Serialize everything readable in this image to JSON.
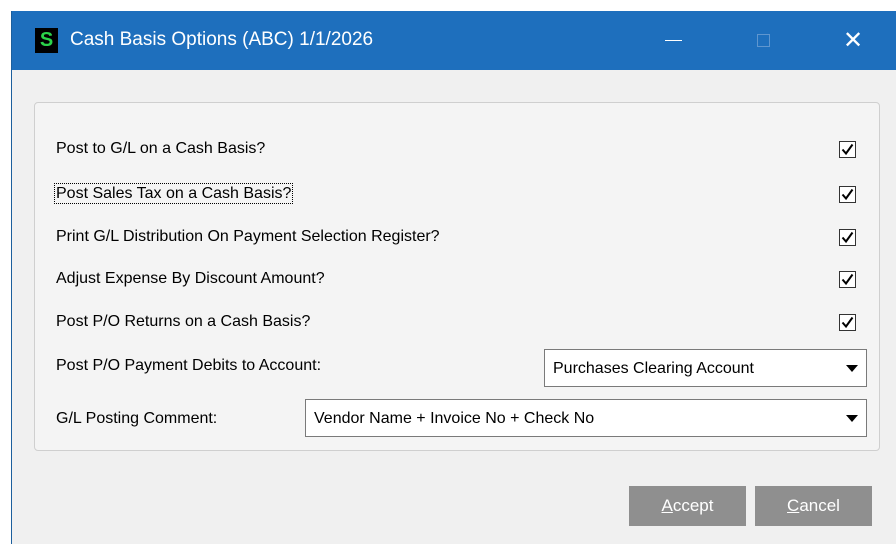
{
  "window": {
    "app_icon_letter": "S",
    "title": "Cash Basis Options (ABC) 1/1/2026",
    "minimize_glyph": "—",
    "close_glyph": "✕"
  },
  "options": [
    {
      "label": "Post to G/L on a Cash Basis?",
      "checked": true
    },
    {
      "label": "Post Sales Tax on a Cash Basis?",
      "checked": true
    },
    {
      "label": "Print G/L Distribution On Payment Selection Register?",
      "checked": true
    },
    {
      "label": "Adjust Expense By Discount Amount?",
      "checked": true
    },
    {
      "label": "Post P/O Returns on a Cash Basis?",
      "checked": true
    }
  ],
  "debits_account": {
    "label": "Post P/O Payment Debits to Account:",
    "value": "Purchases Clearing Account"
  },
  "posting_comment": {
    "label": "G/L Posting Comment:",
    "value": "Vendor Name + Invoice No + Check No"
  },
  "buttons": {
    "accept_mnemonic": "A",
    "accept_rest": "ccept",
    "cancel_mnemonic": "C",
    "cancel_rest": "ancel"
  },
  "icons": {
    "app": "sage-s-icon",
    "minimize": "minimize-icon",
    "maximize": "maximize-icon",
    "close": "close-icon",
    "checkbox": "checkmark-icon",
    "dropdown": "chevron-down-icon"
  },
  "colors": {
    "titlebar": "#1e6fbd",
    "button_disabled": "#8f8f8f",
    "app_icon_letter": "#2bd34a"
  }
}
